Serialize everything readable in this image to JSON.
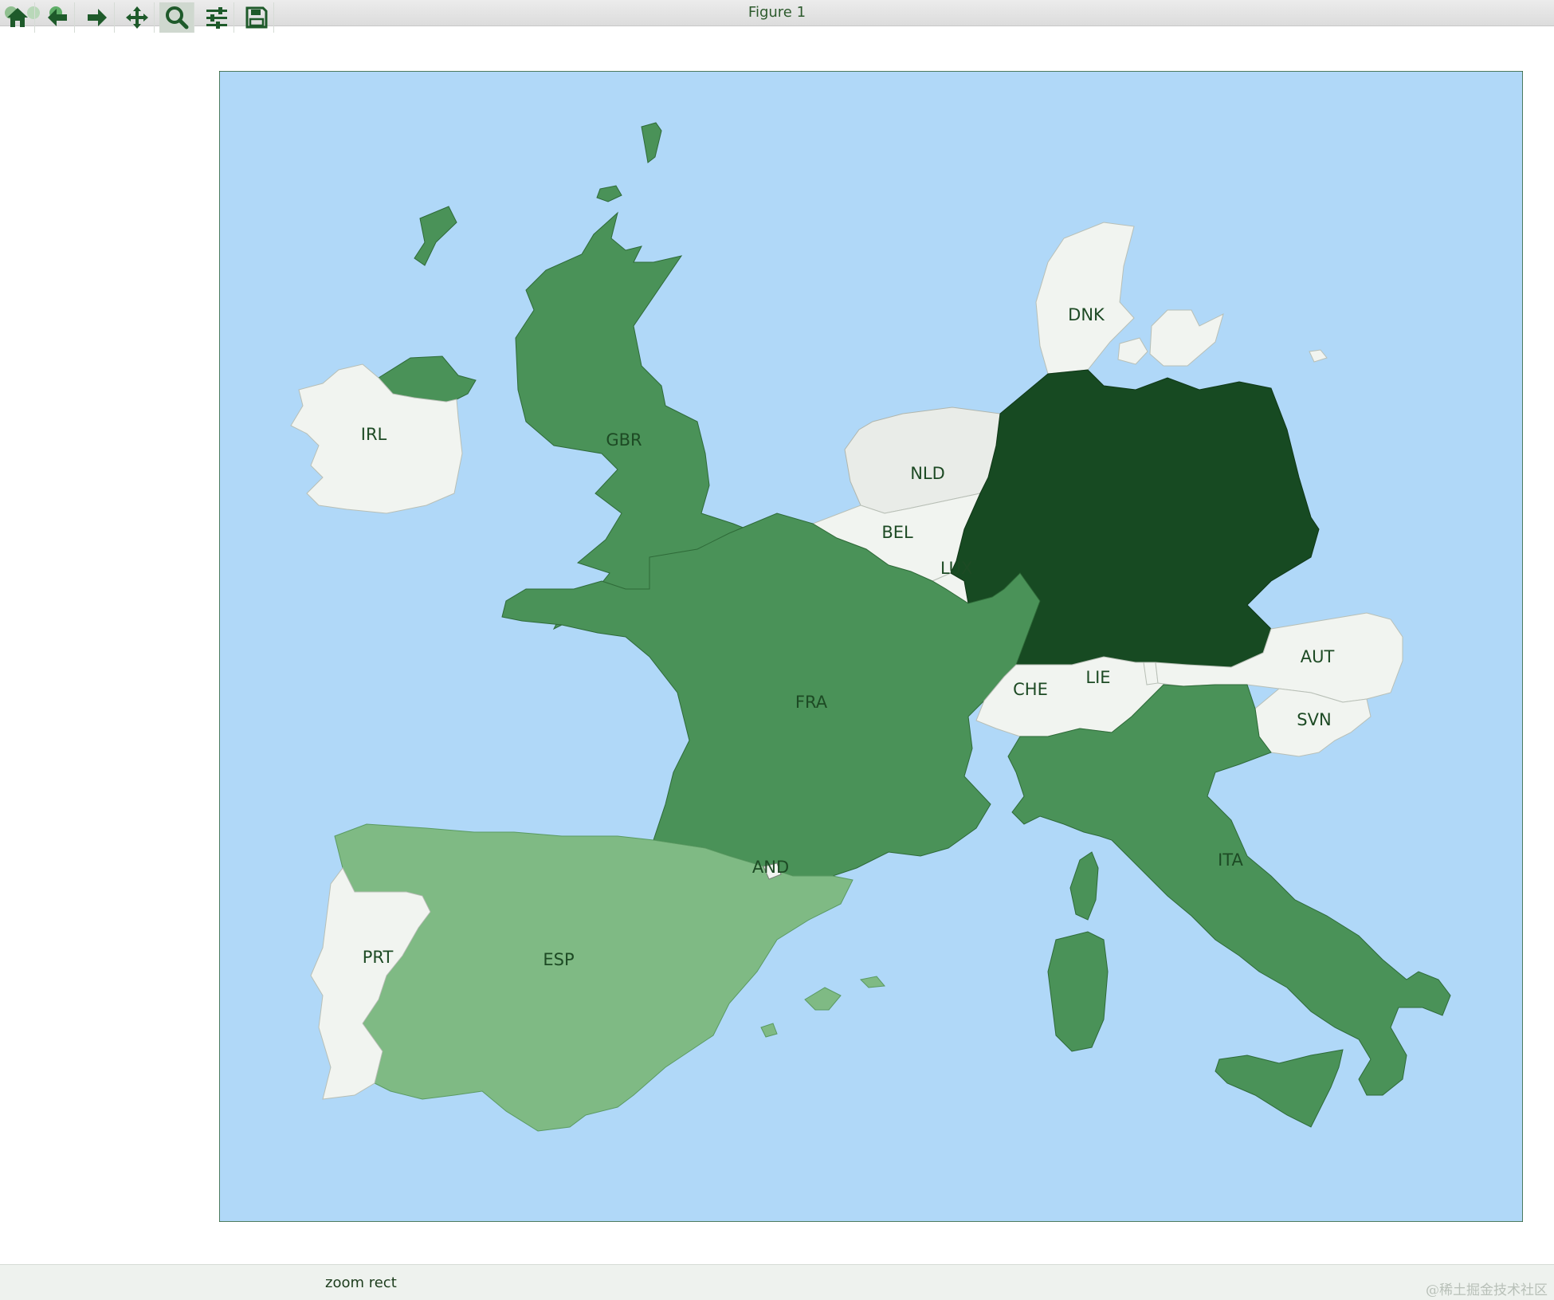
{
  "window": {
    "title": "Figure 1"
  },
  "map": {
    "ocean_color": "#b0d8f8",
    "frame_color": "#2b5a2b",
    "color_scale": {
      "lowest": "#f1f4f0",
      "low": "#7fba84",
      "mid": "#4a9258",
      "highest": "#174a22"
    },
    "countries": [
      {
        "code": "GBR",
        "label": "GBR",
        "fill": "#4a9258"
      },
      {
        "code": "IRL",
        "label": "IRL",
        "fill": "#f1f4f0"
      },
      {
        "code": "FRA",
        "label": "FRA",
        "fill": "#4a9258"
      },
      {
        "code": "ESP",
        "label": "ESP",
        "fill": "#7fba84"
      },
      {
        "code": "PRT",
        "label": "PRT",
        "fill": "#f1f4f0"
      },
      {
        "code": "AND",
        "label": "AND",
        "fill": "#f1f4f0"
      },
      {
        "code": "DEU",
        "label": "",
        "fill": "#174a22"
      },
      {
        "code": "NLD",
        "label": "NLD",
        "fill": "#e9ece8"
      },
      {
        "code": "BEL",
        "label": "BEL",
        "fill": "#f1f4f0"
      },
      {
        "code": "LUX",
        "label": "LUX",
        "fill": "#f1f4f0"
      },
      {
        "code": "DNK",
        "label": "DNK",
        "fill": "#f1f4f0"
      },
      {
        "code": "CHE",
        "label": "CHE",
        "fill": "#f1f4f0"
      },
      {
        "code": "LIE",
        "label": "LIE",
        "fill": "#f1f4f0"
      },
      {
        "code": "AUT",
        "label": "AUT",
        "fill": "#f1f4f0"
      },
      {
        "code": "SVN",
        "label": "SVN",
        "fill": "#f1f4f0"
      },
      {
        "code": "ITA",
        "label": "ITA",
        "fill": "#4a9258"
      }
    ]
  },
  "toolbar": {
    "buttons": [
      {
        "name": "home-button",
        "icon": "home-icon"
      },
      {
        "name": "back-button",
        "icon": "arrow-left-icon"
      },
      {
        "name": "forward-button",
        "icon": "arrow-right-icon"
      },
      {
        "name": "pan-button",
        "icon": "move-icon"
      },
      {
        "name": "zoom-button",
        "icon": "magnifier-icon",
        "active": true
      },
      {
        "name": "configure-subplots-button",
        "icon": "sliders-icon"
      },
      {
        "name": "save-button",
        "icon": "floppy-disk-icon"
      }
    ],
    "status": "zoom rect"
  },
  "watermark": "@稀土掘金技术社区"
}
